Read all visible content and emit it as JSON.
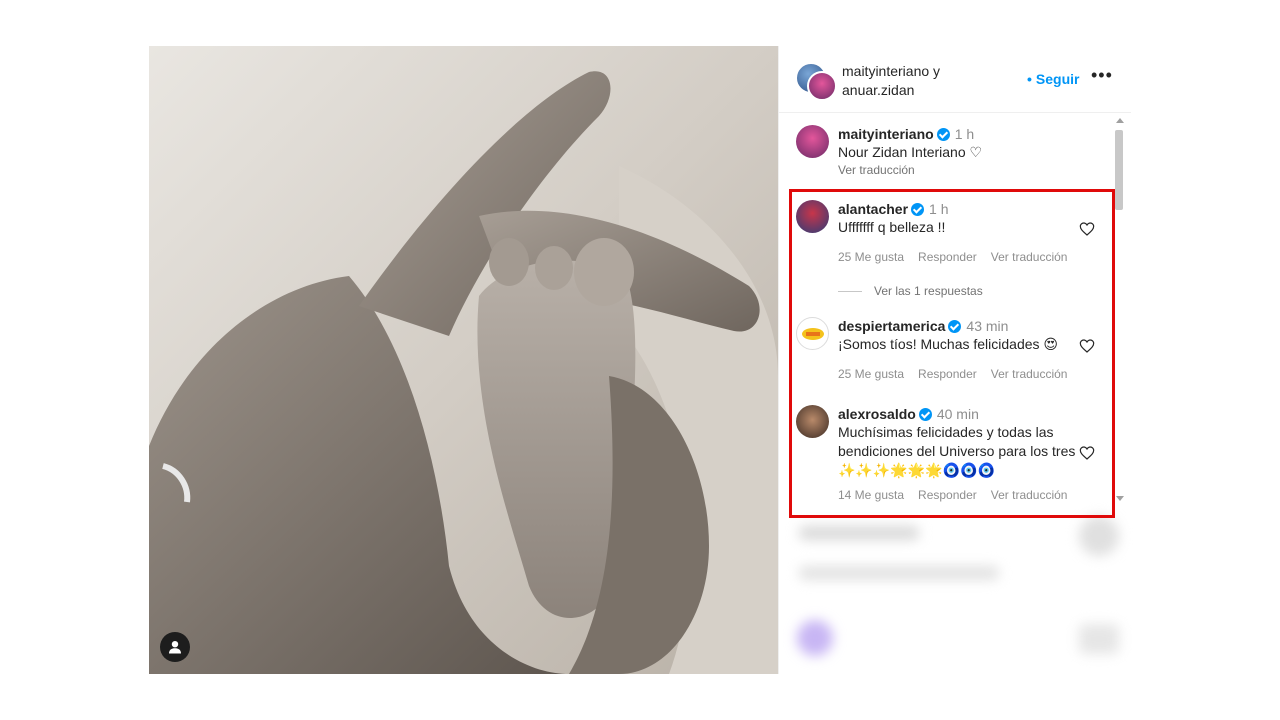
{
  "post": {
    "header": {
      "title": "maityinteriano y anuar.zidan",
      "follow_label": "Seguir",
      "more_label": "•••"
    },
    "caption": {
      "user": "maityinteriano",
      "time": "1 h",
      "text": "Nour Zidan Interiano ♡",
      "translate": "Ver traducción"
    }
  },
  "comments": [
    {
      "user": "alantacher",
      "time": "1 h",
      "text": "Ufffffff q belleza !!",
      "likes": "25 Me gusta",
      "reply": "Responder",
      "translate": "Ver traducción"
    },
    {
      "user": "despiertamerica",
      "time": "43 min",
      "text": "¡Somos tíos! Muchas felicidades 😍",
      "likes": "25 Me gusta",
      "reply": "Responder",
      "translate": "Ver traducción"
    },
    {
      "user": "alexrosaldo",
      "time": "40 min",
      "text": "Muchísimas felicidades y todas las bendiciones del Universo para los tres ✨✨✨🌟🌟🌟🧿🧿🧿",
      "likes": "14 Me gusta",
      "reply": "Responder",
      "translate": "Ver traducción"
    }
  ],
  "view_replies": "Ver las 1 respuestas",
  "colors": {
    "accent": "#0095f6",
    "highlight": "#e00a0a"
  },
  "icons": [
    "user-tag-icon",
    "heart-icon",
    "verified-icon",
    "more-icon"
  ]
}
